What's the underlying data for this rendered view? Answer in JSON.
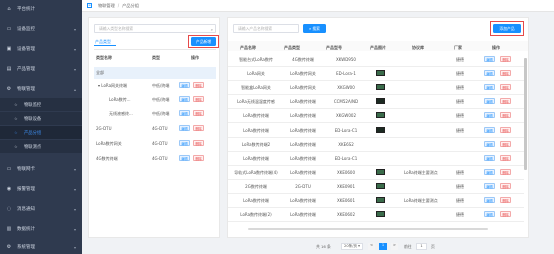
{
  "sidebar": {
    "items": [
      {
        "label": "平台统计",
        "icon": "home-icon"
      },
      {
        "label": "设备监控",
        "icon": "monitor-icon"
      },
      {
        "label": "设备管理",
        "icon": "device-icon"
      },
      {
        "label": "产品管理",
        "icon": "box-icon"
      },
      {
        "label": "物联管理",
        "icon": "gear-icon"
      }
    ],
    "subitems": [
      {
        "label": "物联监控"
      },
      {
        "label": "物联设备"
      },
      {
        "label": "产品分组"
      },
      {
        "label": "物联测点"
      }
    ],
    "lower_items": [
      {
        "label": "物联网卡",
        "icon": "card-icon"
      },
      {
        "label": "报警管理",
        "icon": "alarm-icon"
      },
      {
        "label": "消息通知",
        "icon": "bell-icon"
      },
      {
        "label": "数据统计",
        "icon": "chart-icon"
      },
      {
        "label": "系统管理",
        "icon": "system-icon"
      }
    ]
  },
  "breadcrumb": {
    "first": "物联管理",
    "sep": "/",
    "second": "产品分组"
  },
  "left_panel": {
    "search_placeholder": "请输入类型名称搜索",
    "tab_label": "产品类型",
    "add_button": "产品新增",
    "headers": {
      "name": "类型名称",
      "desc": "类型",
      "action": "操作"
    },
    "rows": [
      {
        "name": "全部",
        "desc": ""
      },
      {
        "name": "LoRa网关终端",
        "desc": "中低/终端"
      },
      {
        "name": "LoRa数传...",
        "desc": "中低/终端"
      },
      {
        "name": "无线液感终...",
        "desc": "中低/终端"
      },
      {
        "name": "2G-DTU",
        "desc": "4G-DTU"
      },
      {
        "name": "LoRa数传网关",
        "desc": "4G-DTU"
      },
      {
        "name": "4G数传终端",
        "desc": "4G-DTU"
      }
    ],
    "edit_label": "编辑",
    "delete_label": "删除"
  },
  "right_panel": {
    "search_placeholder": "请输入产品名称搜索",
    "search_button": "搜索",
    "add_button": "添加产品",
    "headers": {
      "name": "产品名称",
      "type": "产品类型",
      "model": "产品型号",
      "image": "产品图片",
      "lib": "协议库",
      "vendor": "厂家",
      "action": "操作"
    },
    "rows": [
      {
        "name": "智能台式LoRa数传",
        "type": "4G数传终端",
        "model": "XKWD950",
        "img": false,
        "lib": "",
        "vendor": "捷德"
      },
      {
        "name": "LoRa网关",
        "type": "LoRa数传网关",
        "model": "ED-Lora-1",
        "img": true,
        "lib": "",
        "vendor": "捷德"
      },
      {
        "name": "智能盒LoRa网关",
        "type": "LoRa数传网关",
        "model": "XKGW00",
        "img": true,
        "lib": "",
        "vendor": "捷德"
      },
      {
        "name": "LoRa无线温湿度传感",
        "type": "LoRa数传终端",
        "model": "CCM52A/ND",
        "img": true,
        "dark": true,
        "lib": "",
        "vendor": "捷德"
      },
      {
        "name": "LoRa数传终端",
        "type": "LoRa数传终端",
        "model": "XKGW002",
        "img": true,
        "lib": "",
        "vendor": "捷德"
      },
      {
        "name": "LoRa数传终端",
        "type": "LoRa数传终端",
        "model": "ED-Lora-C1",
        "img": true,
        "dark": true,
        "lib": "",
        "vendor": "捷德"
      },
      {
        "name": "LoRa数传终端2",
        "type": "LoRa数传终端",
        "model": "XKE6S2",
        "img": false,
        "lib": "",
        "vendor": ""
      },
      {
        "name": "LoRa数传终端",
        "type": "LoRa数传终端",
        "model": "ED-Lora-C1",
        "img": false,
        "lib": "",
        "vendor": ""
      },
      {
        "name": "导轨式LoRa数传终端(4)",
        "type": "LoRa数传终端",
        "model": "XKE0600",
        "img": true,
        "lib": "LoRa终端主要测点",
        "vendor": "捷德"
      },
      {
        "name": "2G数传终端",
        "type": "2G-DTU",
        "model": "XKE0901",
        "img": true,
        "lib": "",
        "vendor": "捷德"
      },
      {
        "name": "LoRa数传终端",
        "type": "LoRa数传终端",
        "model": "XKE0601",
        "img": true,
        "lib": "LoRa终端主要测点",
        "vendor": "捷德"
      },
      {
        "name": "LoRa数传终端(2)",
        "type": "LoRa数传终端",
        "model": "XKE0602",
        "img": true,
        "lib": "",
        "vendor": "捷德"
      }
    ],
    "edit_label": "编辑",
    "delete_label": "删除"
  },
  "pagination": {
    "total": "共 16 条",
    "page_size": "20条/页",
    "prev": "<",
    "current_page": "1",
    "next": ">",
    "goto_label": "前往",
    "goto_value": "1",
    "page_unit": "页"
  }
}
